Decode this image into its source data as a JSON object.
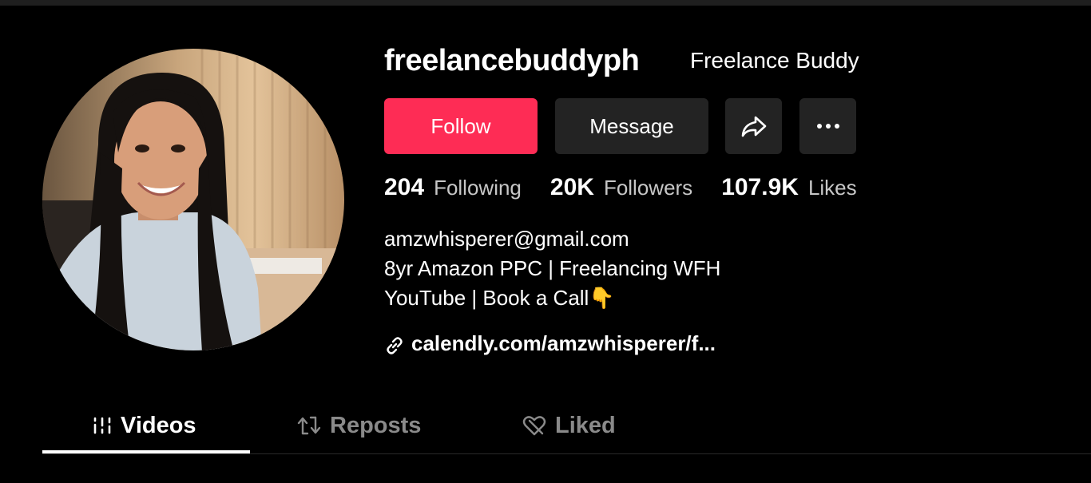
{
  "profile": {
    "username": "freelancebuddyph",
    "display_name": "Freelance Buddy"
  },
  "actions": {
    "follow_label": "Follow",
    "message_label": "Message",
    "share_icon": "share-arrow-icon",
    "more_icon": "more-dots-icon",
    "follow_color": "#fe2c55"
  },
  "stats": [
    {
      "value": "204",
      "label": "Following"
    },
    {
      "value": "20K",
      "label": "Followers"
    },
    {
      "value": "107.9K",
      "label": "Likes"
    }
  ],
  "bio": {
    "lines": [
      "amzwhisperer@gmail.com",
      "8yr Amazon PPC | Freelancing WFH",
      "YouTube | Book a Call👇"
    ],
    "link": "calendly.com/amzwhisperer/f..."
  },
  "tabs": [
    {
      "label": "Videos",
      "icon": "grid-bars-icon",
      "active": true
    },
    {
      "label": "Reposts",
      "icon": "repost-arrows-icon",
      "active": false
    },
    {
      "label": "Liked",
      "icon": "heart-off-icon",
      "active": false
    }
  ]
}
